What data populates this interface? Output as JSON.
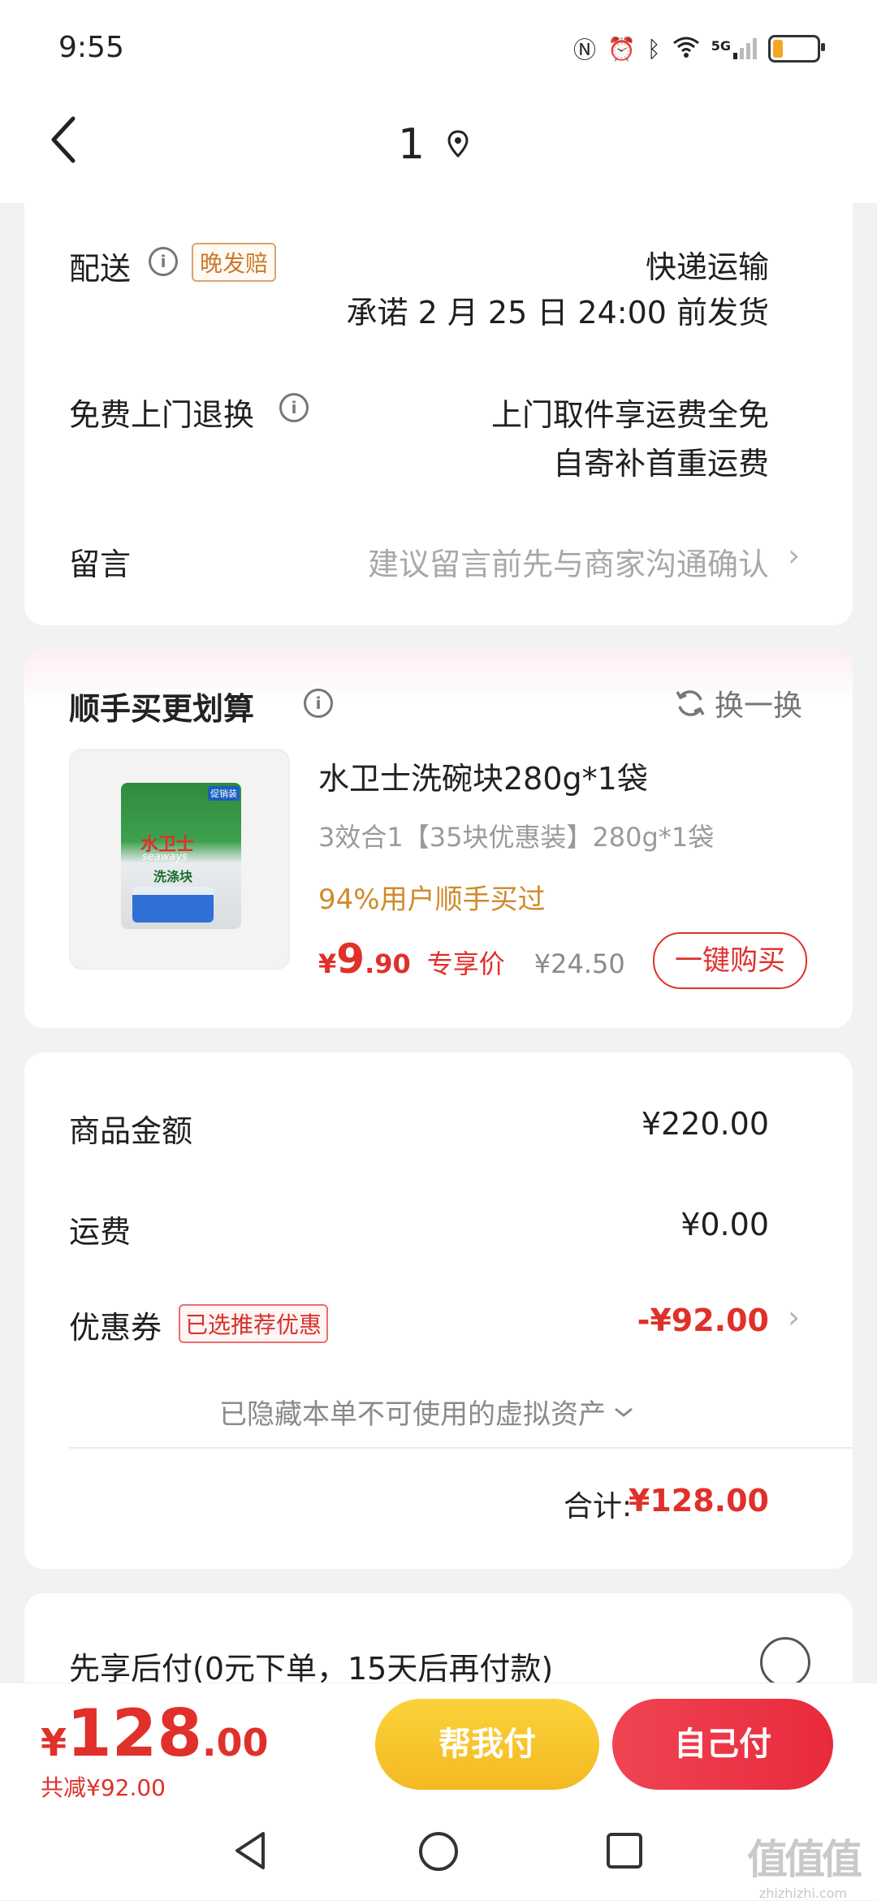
{
  "status_bar": {
    "time": "9:55",
    "network": "5G"
  },
  "header": {
    "title": "1"
  },
  "delivery": {
    "label": "配送",
    "tag": "晚发赔",
    "method": "快递运输",
    "promise": "承诺 2 月 25 日 24:00 前发货"
  },
  "returns": {
    "label": "免费上门退换",
    "line1": "上门取件享运费全免",
    "line2": "自寄补首重运费"
  },
  "message": {
    "label": "留言",
    "placeholder": "建议留言前先与商家沟通确认"
  },
  "addon": {
    "title": "顺手买更划算",
    "swap_label": "换一换",
    "product": {
      "name": "水卫士洗碗块280g*1袋",
      "spec": "3效合1【35块优惠装】280g*1袋",
      "social": "94%用户顺手买过",
      "price_symbol": "¥",
      "price_int": "9",
      "price_dec": ".90",
      "price_label": "专享价",
      "original_price": "¥24.50",
      "buy_button": "一键购买",
      "package_brand": "水卫士",
      "package_brand_en": "seaways",
      "package_name": "洗涤块",
      "package_badge": "促销装"
    }
  },
  "summary": {
    "goods_label": "商品金额",
    "goods_value": "¥220.00",
    "shipping_label": "运费",
    "shipping_value": "¥0.00",
    "coupon_label": "优惠券",
    "coupon_tag": "已选推荐优惠",
    "coupon_value": "-¥92.00",
    "hidden_assets": "已隐藏本单不可使用的虚拟资产",
    "total_label": "合计:",
    "total_value": "¥128.00"
  },
  "pay_later": {
    "label": "先享后付(0元下单，15天后再付款)"
  },
  "bottom_bar": {
    "symbol": "¥",
    "amount_int": "128",
    "amount_dec": ".00",
    "saved": "共减¥92.00",
    "help_pay": "帮我付",
    "self_pay": "自己付"
  },
  "watermark": {
    "text": "值值值",
    "sub": "zhizhizhi.com"
  },
  "colors": {
    "accent_red": "#e0302a",
    "help_pay_yellow": "#f8c42d",
    "self_pay_red": "#ef3446",
    "tag_orange": "#c87b2c"
  }
}
